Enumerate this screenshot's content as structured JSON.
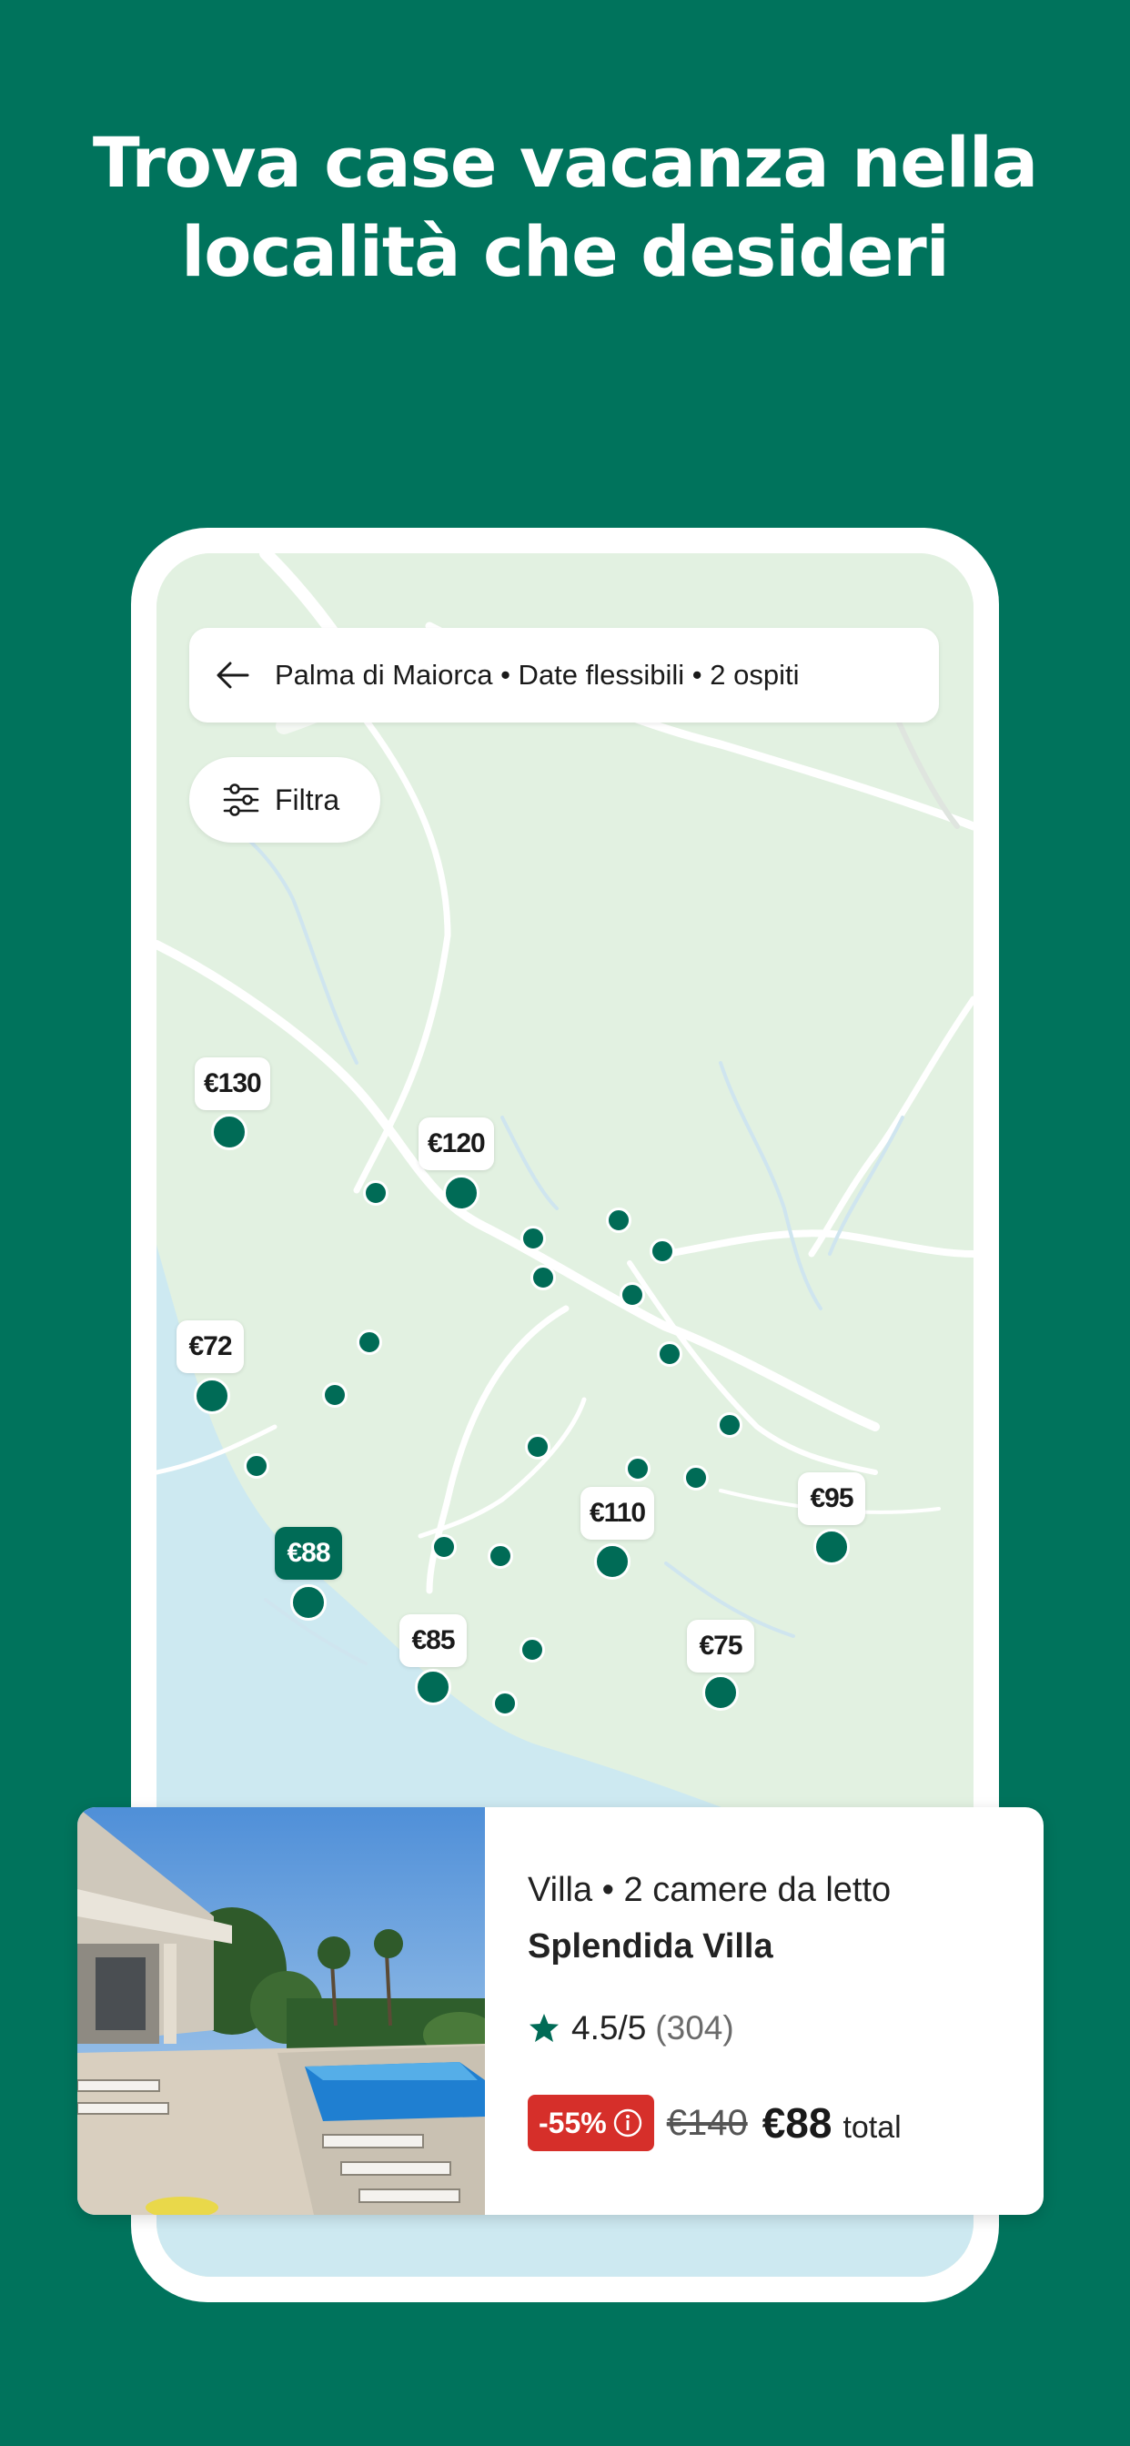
{
  "headline": {
    "line1": "Trova case vacanza nella",
    "line2": "località che desideri"
  },
  "colors": {
    "brand": "#00735c",
    "pin": "#006b56",
    "discount": "#d62f2a",
    "map_land": "#e2f1e1",
    "map_sea": "#cde9f1"
  },
  "search": {
    "back_icon": "arrow-left-icon",
    "query": "Palma di Maiorca • Date flessibili • 2 ospiti"
  },
  "filter": {
    "icon": "sliders-icon",
    "label": "Filtra"
  },
  "map": {
    "price_pins": [
      {
        "label": "€130",
        "selected": false
      },
      {
        "label": "€120",
        "selected": false
      },
      {
        "label": "€72",
        "selected": false
      },
      {
        "label": "€88",
        "selected": true
      },
      {
        "label": "€110",
        "selected": false
      },
      {
        "label": "€95",
        "selected": false
      },
      {
        "label": "€85",
        "selected": false
      },
      {
        "label": "€75",
        "selected": false
      }
    ]
  },
  "listing": {
    "type": "Villa • 2 camere da letto",
    "name": "Splendida Villa",
    "rating": "4.5/5",
    "reviews": "(304)",
    "discount": "-55%",
    "old_price": "€140",
    "price": "€88",
    "price_suffix": "total"
  }
}
